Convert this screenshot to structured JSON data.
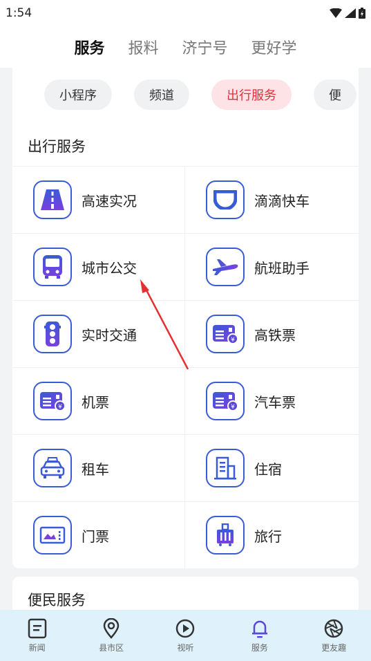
{
  "status_bar": {
    "time": "1:54"
  },
  "top_tabs": [
    {
      "label": "服务",
      "active": true
    },
    {
      "label": "报料",
      "active": false
    },
    {
      "label": "济宁号",
      "active": false
    },
    {
      "label": "更好学",
      "active": false
    }
  ],
  "chips": [
    {
      "label": "小程序",
      "active": false
    },
    {
      "label": "频道",
      "active": false
    },
    {
      "label": "出行服务",
      "active": true
    },
    {
      "label": "便",
      "active": false
    }
  ],
  "section_main": {
    "title": "出行服务",
    "items": [
      {
        "label": "高速实况",
        "icon": "highway-icon"
      },
      {
        "label": "滴滴快车",
        "icon": "didi-icon"
      },
      {
        "label": "城市公交",
        "icon": "bus-icon"
      },
      {
        "label": "航班助手",
        "icon": "airplane-icon"
      },
      {
        "label": "实时交通",
        "icon": "traffic-light-icon"
      },
      {
        "label": "高铁票",
        "icon": "ticket-icon"
      },
      {
        "label": "机票",
        "icon": "ticket-icon"
      },
      {
        "label": "汽车票",
        "icon": "ticket-icon"
      },
      {
        "label": "租车",
        "icon": "taxi-icon"
      },
      {
        "label": "住宿",
        "icon": "building-icon"
      },
      {
        "label": "门票",
        "icon": "scenic-ticket-icon"
      },
      {
        "label": "旅行",
        "icon": "travel-icon"
      }
    ]
  },
  "section_second": {
    "title": "便民服务"
  },
  "bottom_nav": [
    {
      "label": "新闻",
      "icon": "news-icon",
      "active": false
    },
    {
      "label": "县市区",
      "icon": "location-pin-icon",
      "active": false
    },
    {
      "label": "视听",
      "icon": "play-icon",
      "active": false
    },
    {
      "label": "服务",
      "icon": "bell-icon",
      "active": true
    },
    {
      "label": "更友趣",
      "icon": "aperture-icon",
      "active": false
    }
  ],
  "colors": {
    "accent": "#e0303d",
    "icon_blue": "#3a5bd6",
    "icon_purple": "#7a3fe0",
    "nav_bg": "#dff2fb"
  }
}
